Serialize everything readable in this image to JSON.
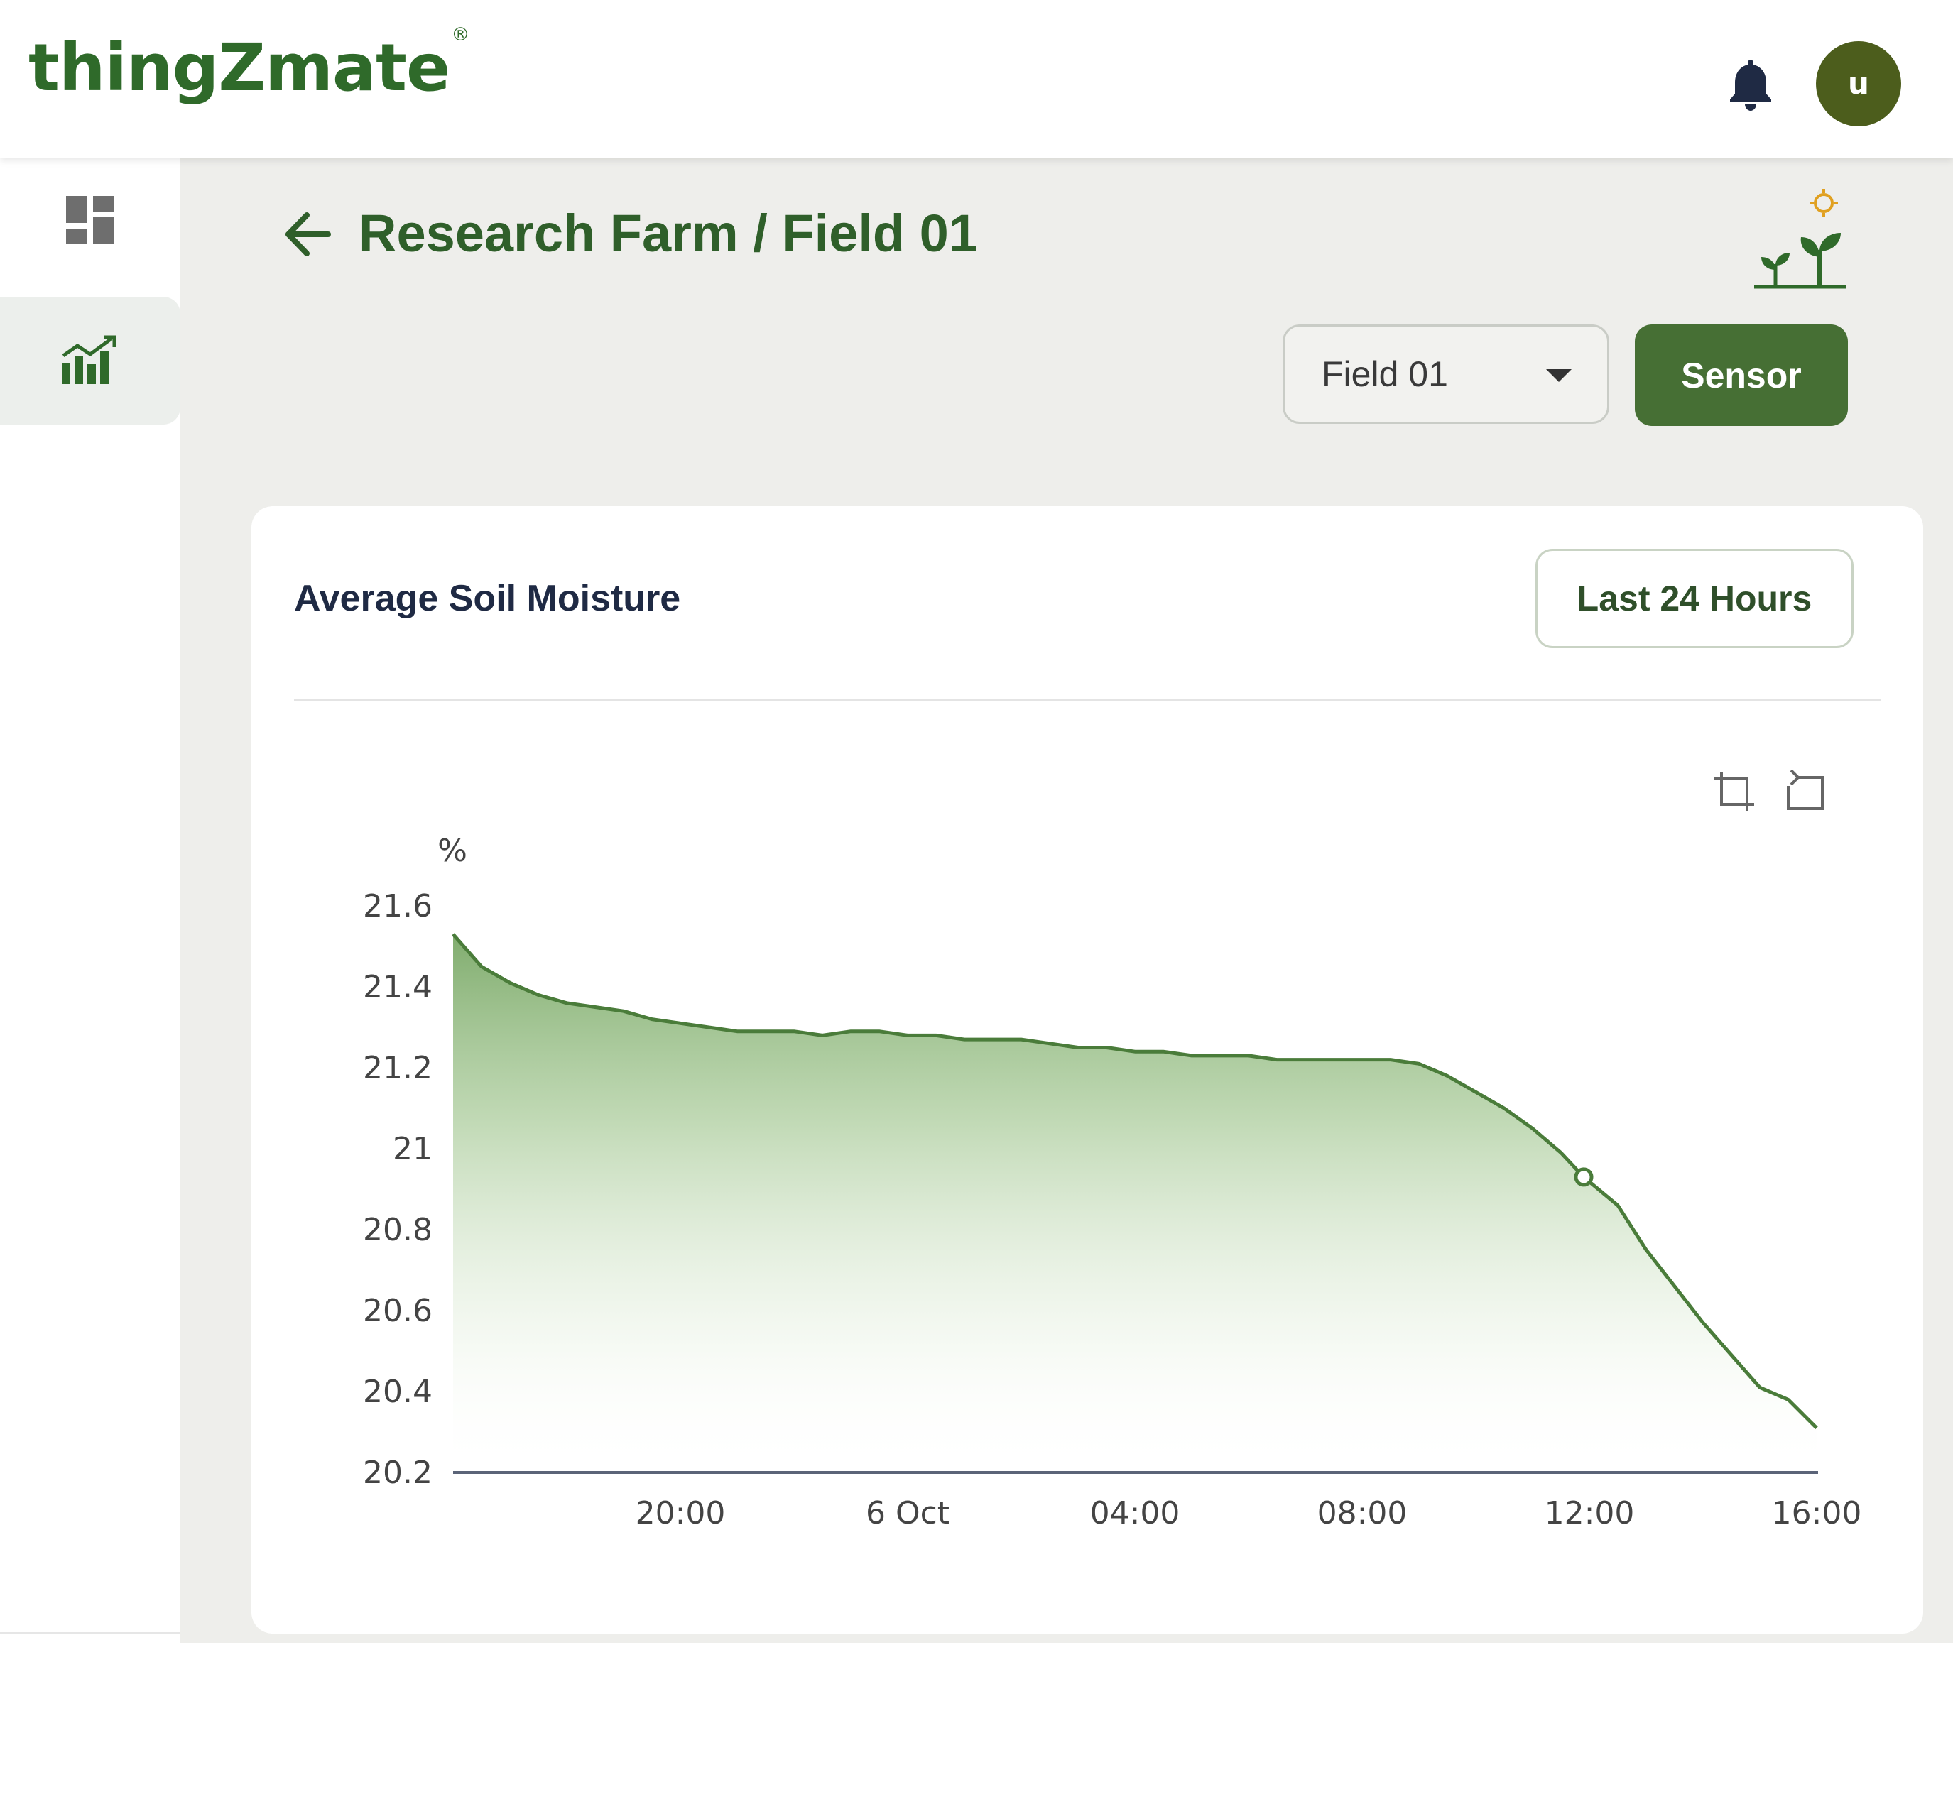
{
  "app": {
    "logo": "thingZmate",
    "logo_mark": "®",
    "avatar_letter": "u",
    "brand_color": "#466f34"
  },
  "icons": {
    "notifications": "bell-icon",
    "dashboard": "dashboard-grid-icon",
    "analytics": "analytics-chart-icon",
    "back": "arrow-left-icon",
    "farm": "sprout-icon",
    "zoom": "zoom-area-icon",
    "zoom_reset": "zoom-reset-icon"
  },
  "page": {
    "breadcrumb": "Research Farm / Field 01"
  },
  "controls": {
    "field_select_value": "Field 01",
    "sensor_button": "Sensor"
  },
  "card": {
    "title": "Average Soil Moisture",
    "range_button": "Last 24 Hours"
  },
  "chart_data": {
    "type": "area",
    "title": "Average Soil Moisture",
    "ylabel": "%",
    "xlabel": "",
    "ylim": [
      20.2,
      21.6
    ],
    "y_ticks": [
      "20.2",
      "20.4",
      "20.6",
      "20.8",
      "21",
      "21.2",
      "21.4",
      "21.6"
    ],
    "x_ticks": [
      {
        "label": "20:00",
        "hour": 20
      },
      {
        "label": "6 Oct",
        "hour": 24
      },
      {
        "label": "04:00",
        "hour": 28
      },
      {
        "label": "08:00",
        "hour": 32
      },
      {
        "label": "12:00",
        "hour": 36
      },
      {
        "label": "16:00",
        "hour": 40
      }
    ],
    "x_range_hours": [
      16,
      40
    ],
    "series": [
      {
        "color": "#4a7c3a",
        "points": [
          [
            16.0,
            21.53
          ],
          [
            16.5,
            21.45
          ],
          [
            17.0,
            21.41
          ],
          [
            17.5,
            21.38
          ],
          [
            18.0,
            21.36
          ],
          [
            18.5,
            21.35
          ],
          [
            19.0,
            21.34
          ],
          [
            19.5,
            21.32
          ],
          [
            20.0,
            21.31
          ],
          [
            20.5,
            21.3
          ],
          [
            21.0,
            21.29
          ],
          [
            21.5,
            21.29
          ],
          [
            22.0,
            21.29
          ],
          [
            22.5,
            21.28
          ],
          [
            23.0,
            21.29
          ],
          [
            23.5,
            21.29
          ],
          [
            24.0,
            21.28
          ],
          [
            24.5,
            21.28
          ],
          [
            25.0,
            21.27
          ],
          [
            25.5,
            21.27
          ],
          [
            26.0,
            21.27
          ],
          [
            26.5,
            21.26
          ],
          [
            27.0,
            21.25
          ],
          [
            27.5,
            21.25
          ],
          [
            28.0,
            21.24
          ],
          [
            28.5,
            21.24
          ],
          [
            29.0,
            21.23
          ],
          [
            29.5,
            21.23
          ],
          [
            30.0,
            21.23
          ],
          [
            30.5,
            21.22
          ],
          [
            31.0,
            21.22
          ],
          [
            31.5,
            21.22
          ],
          [
            32.0,
            21.22
          ],
          [
            32.5,
            21.22
          ],
          [
            33.0,
            21.21
          ],
          [
            33.5,
            21.18
          ],
          [
            34.0,
            21.14
          ],
          [
            34.5,
            21.1
          ],
          [
            35.0,
            21.05
          ],
          [
            35.5,
            20.99
          ],
          [
            35.9,
            20.93
          ],
          [
            36.5,
            20.86
          ],
          [
            37.0,
            20.75
          ],
          [
            37.5,
            20.66
          ],
          [
            38.0,
            20.57
          ],
          [
            38.5,
            20.49
          ],
          [
            39.0,
            20.41
          ],
          [
            39.5,
            20.38
          ],
          [
            40.0,
            20.31
          ]
        ]
      }
    ],
    "grid": false,
    "legend": "none"
  }
}
